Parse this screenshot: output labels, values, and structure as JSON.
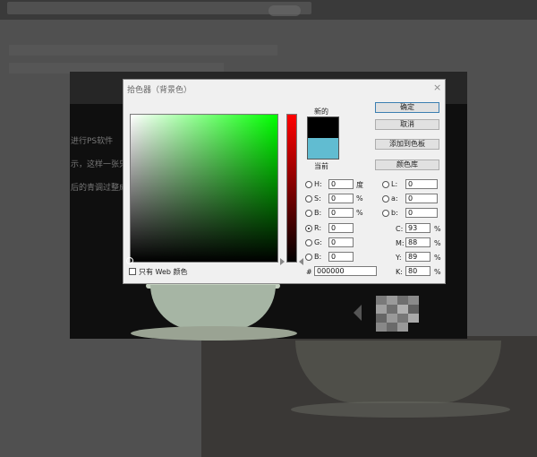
{
  "dialog": {
    "title": "拾色器（背景色）",
    "close_glyph": "×",
    "new_label": "新的",
    "current_label": "当前",
    "new_color": "#000000",
    "current_color": "#61bcd1",
    "buttons": {
      "ok": "确定",
      "cancel": "取消",
      "add_swatch": "添加到色板",
      "library": "颜色库"
    },
    "fields": {
      "H": {
        "label": "H:",
        "value": "0",
        "unit": "度"
      },
      "S": {
        "label": "S:",
        "value": "0",
        "unit": "%"
      },
      "B": {
        "label": "B:",
        "value": "0",
        "unit": "%"
      },
      "R": {
        "label": "R:",
        "value": "0"
      },
      "G": {
        "label": "G:",
        "value": "0"
      },
      "Bl": {
        "label": "B:",
        "value": "0"
      },
      "L": {
        "label": "L:",
        "value": "0"
      },
      "a": {
        "label": "a:",
        "value": "0"
      },
      "b": {
        "label": "b:",
        "value": "0"
      },
      "C": {
        "label": "C:",
        "value": "93",
        "unit": "%"
      },
      "M": {
        "label": "M:",
        "value": "88",
        "unit": "%"
      },
      "Y": {
        "label": "Y:",
        "value": "89",
        "unit": "%"
      },
      "K": {
        "label": "K:",
        "value": "80",
        "unit": "%"
      }
    },
    "hex_label": "#",
    "hex_value": "000000",
    "web_only_label": "只有 Web 颜色"
  },
  "background": {
    "text_fragments": [
      "进行PS软件",
      "示，这样一张只",
      "后的青调过整成"
    ]
  },
  "colors": {
    "accent": "#3c7fb1",
    "hue_top": "#ff0000"
  }
}
